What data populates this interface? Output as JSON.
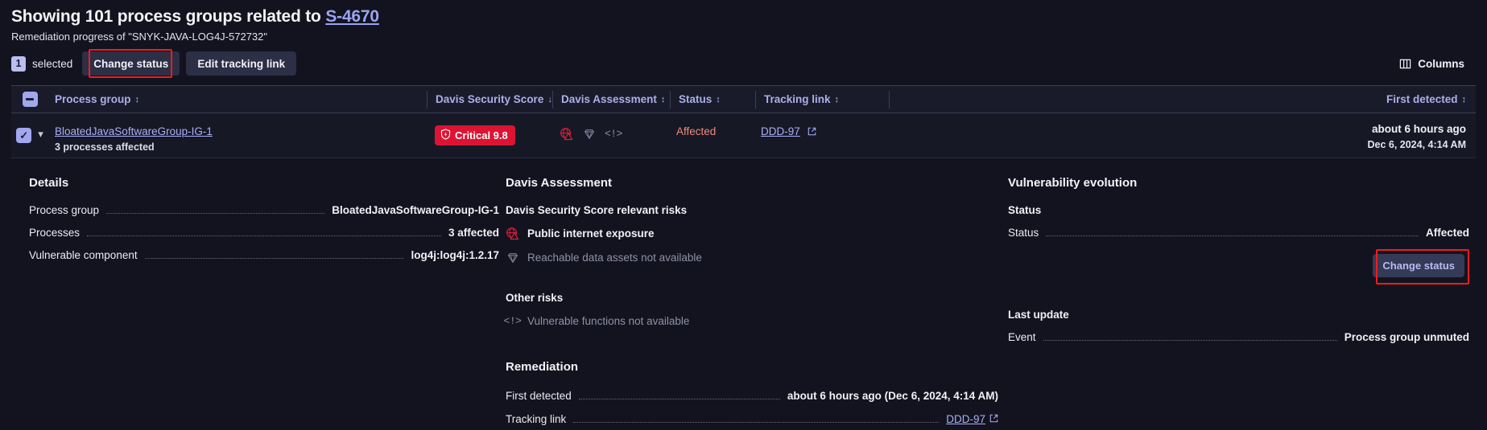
{
  "header": {
    "title_prefix": "Showing 101 process groups related to",
    "title_link": "S-4670",
    "subtitle": "Remediation progress of \"SNYK-JAVA-LOG4J-572732\""
  },
  "toolbar": {
    "selected_count": "1",
    "selected_label": "selected",
    "change_status_label": "Change status",
    "edit_tracking_link_label": "Edit tracking link",
    "columns_label": "Columns",
    "columns_icon": "columns-icon"
  },
  "table": {
    "headers": {
      "process_group": "Process group",
      "davis_security_score": "Davis Security Score",
      "davis_assessment": "Davis Assessment",
      "status": "Status",
      "tracking_link": "Tracking link",
      "first_detected": "First detected"
    },
    "sort": {
      "process_group": "↕",
      "davis_security_score": "↓",
      "davis_assessment": "↕",
      "status": "↕",
      "tracking_link": "↕",
      "first_detected": "↕"
    },
    "row": {
      "process_group": "BloatedJavaSoftwareGroup-IG-1",
      "processes_affected": "3 processes affected",
      "score_label": "Critical 9.8",
      "score_color": "#dc1433",
      "assessment_icons": [
        "public-internet-exposure-icon",
        "reachable-data-assets-icon",
        "vulnerable-functions-icon"
      ],
      "status": "Affected",
      "status_color": "#f08a78",
      "tracking_link": "DDD-97",
      "first_detected_relative": "about 6 hours ago",
      "first_detected_absolute": "Dec 6, 2024, 4:14 AM"
    }
  },
  "details": {
    "heading": "Details",
    "rows": [
      {
        "key": "Process group",
        "value": "BloatedJavaSoftwareGroup-IG-1"
      },
      {
        "key": "Processes",
        "value": "3 affected"
      },
      {
        "key": "Vulnerable component",
        "value": "log4j:log4j:1.2.17"
      }
    ]
  },
  "davis_assessment": {
    "heading": "Davis Assessment",
    "relevant_risks_heading": "Davis Security Score relevant risks",
    "risks": [
      {
        "label": "Public internet exposure",
        "icon": "public-internet-exposure-icon",
        "dim": false
      },
      {
        "label": "Reachable data assets not available",
        "icon": "reachable-data-assets-icon",
        "dim": true
      }
    ],
    "other_risks_heading": "Other risks",
    "other_risks": [
      {
        "label": "Vulnerable functions not available",
        "icon": "vulnerable-functions-icon",
        "dim": true
      }
    ],
    "remediation_heading": "Remediation",
    "remediation_rows": [
      {
        "key": "First detected",
        "value": "about 6 hours ago (Dec 6, 2024, 4:14 AM)"
      },
      {
        "key": "Tracking link",
        "value": "DDD-97"
      }
    ]
  },
  "vulnerability_evolution": {
    "heading": "Vulnerability evolution",
    "status_heading": "Status",
    "status_key": "Status",
    "status_value": "Affected",
    "change_status_label": "Change status",
    "last_update_heading": "Last update",
    "event_key": "Event",
    "event_value": "Process group unmuted"
  },
  "colors": {
    "accent_link": "#a9b0f5",
    "critical": "#dc1433",
    "affected": "#f08a78",
    "highlight_box": "#ef1c1c",
    "background": "#13131f"
  }
}
